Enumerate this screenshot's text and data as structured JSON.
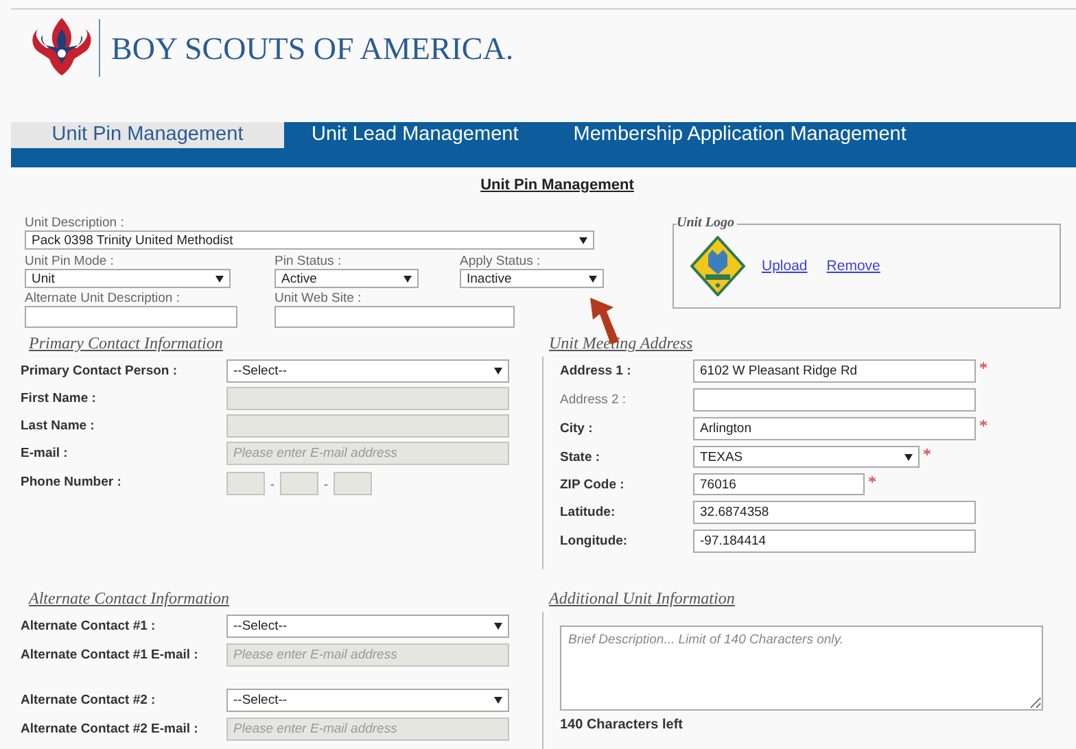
{
  "header": {
    "org_name": "BOY SCOUTS OF AMERICA."
  },
  "tabs": [
    {
      "label": "Unit Pin Management",
      "selected": true
    },
    {
      "label": "Unit Lead Management",
      "selected": false
    },
    {
      "label": "Membership Application Management",
      "selected": false
    }
  ],
  "page_title": "Unit Pin Management",
  "unit": {
    "description": {
      "label": "Unit Description :",
      "value": "Pack 0398 Trinity United Methodist"
    },
    "pin_mode": {
      "label": "Unit Pin Mode :",
      "value": "Unit"
    },
    "pin_status": {
      "label": "Pin Status :",
      "value": "Active"
    },
    "apply_status": {
      "label": "Apply Status :",
      "value": "Inactive"
    },
    "alternate_description": {
      "label": "Alternate Unit Description :"
    },
    "web_site": {
      "label": "Unit Web Site :"
    }
  },
  "unit_logo": {
    "legend": "Unit Logo",
    "links": [
      "Upload",
      "Remove"
    ]
  },
  "primary_contact": {
    "heading": "Primary Contact Information",
    "rows": [
      {
        "label": "Primary Contact Person :",
        "kind": "select",
        "value": "--Select--"
      },
      {
        "label": "First Name :",
        "kind": "text",
        "disabled": true
      },
      {
        "label": "Last Name :",
        "kind": "text",
        "disabled": true
      },
      {
        "label": "E-mail :",
        "kind": "text",
        "disabled": true,
        "placeholder": "Please enter E-mail address"
      },
      {
        "label": "Phone Number :",
        "kind": "phone",
        "separators": [
          "-",
          "-"
        ]
      }
    ]
  },
  "meeting_address": {
    "heading": "Unit Meeting Address",
    "rows": [
      {
        "label": "Address 1 :",
        "kind": "text",
        "value": "6102 W Pleasant Ridge Rd",
        "required": true,
        "strong": true
      },
      {
        "label": "Address 2 :",
        "kind": "text",
        "required": false,
        "strong": false
      },
      {
        "label": "City :",
        "kind": "text",
        "value": "Arlington",
        "required": true,
        "strong": true
      },
      {
        "label": "State :",
        "kind": "select",
        "value": "TEXAS",
        "required": true,
        "strong": true
      },
      {
        "label": "ZIP Code :",
        "kind": "shorttext",
        "value": "76016",
        "required": true,
        "strong": true
      },
      {
        "label": "Latitude:",
        "kind": "text",
        "value": "32.6874358",
        "required": false,
        "strong": true
      },
      {
        "label": "Longitude:",
        "kind": "text",
        "value": "-97.184414",
        "required": false,
        "strong": true
      }
    ]
  },
  "alternate_contact": {
    "heading": "Alternate Contact Information",
    "rows": [
      {
        "label": "Alternate Contact #1 :",
        "kind": "select",
        "value": "--Select--"
      },
      {
        "label": "Alternate Contact #1 E-mail :",
        "kind": "text",
        "disabled": true,
        "placeholder": "Please enter E-mail address"
      },
      {
        "label": "Alternate Contact #2 :",
        "kind": "select",
        "value": "--Select--"
      },
      {
        "label": "Alternate Contact #2 E-mail :",
        "kind": "text",
        "disabled": true,
        "placeholder": "Please enter E-mail address"
      }
    ]
  },
  "additional_info": {
    "heading": "Additional Unit Information",
    "placeholder": "Brief Description... Limit of 140 Characters only.",
    "counter": "140 Characters left"
  }
}
